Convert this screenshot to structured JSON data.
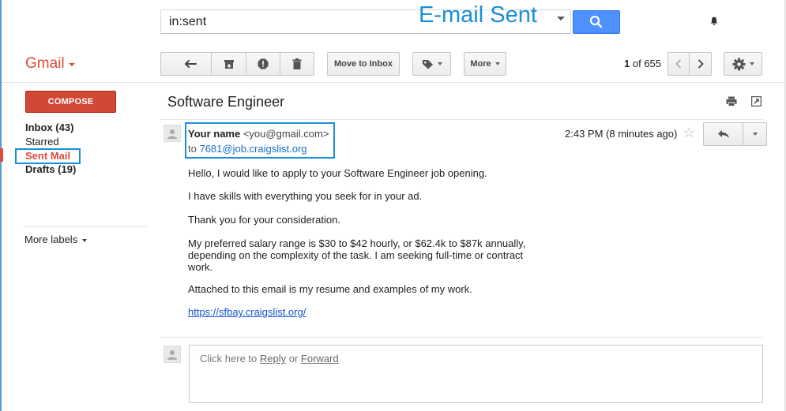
{
  "search": {
    "value": "in:sent",
    "overlay_label": "E-mail Sent"
  },
  "brand": {
    "logo": "Gmail"
  },
  "toolbar": {
    "move_to_inbox": "Move to Inbox",
    "more": "More",
    "pager_current": "1",
    "pager_of": " of ",
    "pager_total": "655"
  },
  "sidebar": {
    "compose": "COMPOSE",
    "items": [
      {
        "label": "Inbox (43)"
      },
      {
        "label": "Starred"
      },
      {
        "label": "Sent Mail"
      },
      {
        "label": "Drafts (19)"
      }
    ],
    "more_labels": "More labels"
  },
  "message": {
    "subject": "Software Engineer",
    "sender_name": "Your name",
    "sender_email": "<you@gmail.com>",
    "to_prefix": "to ",
    "to_address": "7681@job.craigslist.org",
    "time": "2:43 PM (8 minutes ago)",
    "body": [
      "Hello, I would like to apply to your Software Engineer job opening.",
      "I have skills with everything you seek for in your ad.",
      "Thank you for your consideration.",
      "My preferred salary range is $30 to $42 hourly, or $62.4k to $87k annually, depending on the complexity of the task. I am seeking full-time or contract work.",
      "Attached to this email is my resume and examples of my work."
    ],
    "link": "https://sfbay.craigslist.org/"
  },
  "reply": {
    "prefix": "Click here to ",
    "reply_link": "Reply",
    "or": " or ",
    "forward_link": "Forward"
  },
  "colors": {
    "accent_red": "#dd4b39",
    "accent_blue": "#4d90fe",
    "annotation_blue": "#1a8fd8"
  },
  "icons": [
    "back-arrow-icon",
    "archive-icon",
    "spam-icon",
    "trash-icon",
    "label-icon",
    "chevron-left-icon",
    "chevron-right-icon",
    "gear-icon",
    "search-icon",
    "bell-icon",
    "print-icon",
    "new-window-icon",
    "star-icon",
    "reply-icon",
    "avatar-icon"
  ]
}
